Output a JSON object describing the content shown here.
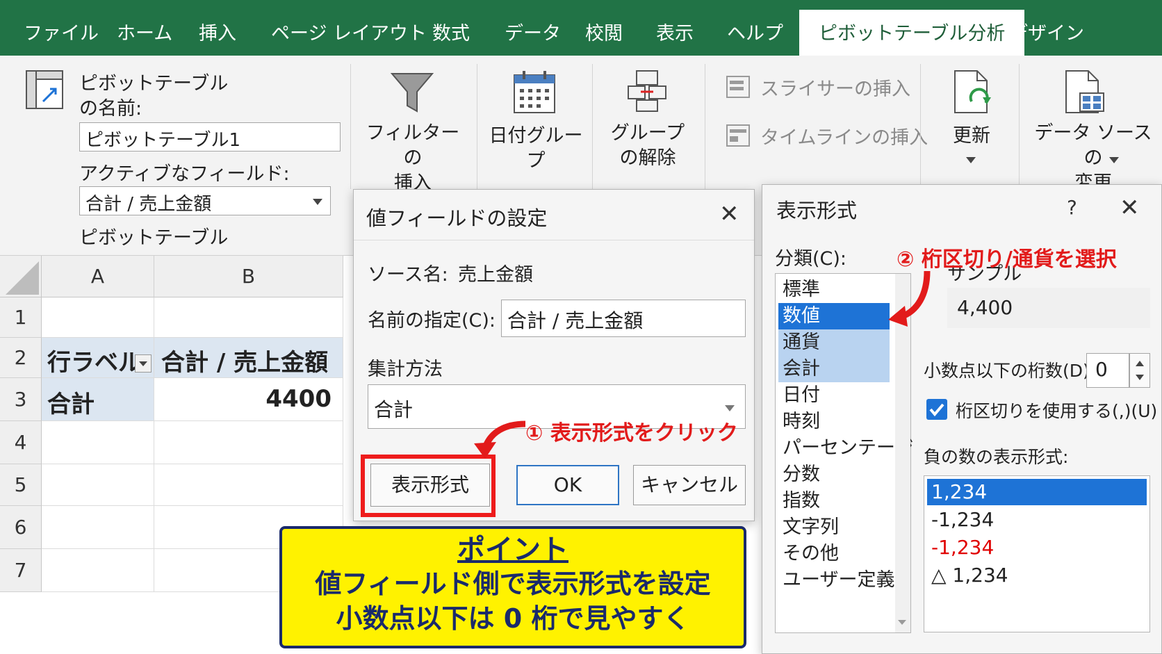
{
  "tabs": [
    "ファイル",
    "ホーム",
    "挿入",
    "ページ レイアウト",
    "数式",
    "データ",
    "校閲",
    "表示",
    "ヘルプ",
    "ピボットテーブル分析",
    "デザイン"
  ],
  "ribbon": {
    "pt_name_label_1": "ピボットテーブル",
    "pt_name_label_2": "の名前:",
    "pt_name_value": "ピボットテーブル1",
    "active_field_label": "アクティブなフィールド:",
    "active_field_value": "合計 / 売上金額",
    "group_label": "ピボットテーブル",
    "filter_1": "フィルターの",
    "filter_2": "挿入",
    "date_group": "日付グループ",
    "ungroup_1": "グループ",
    "ungroup_2": "の解除",
    "slicer": "スライサーの挿入",
    "timeline": "タイムラインの挿入",
    "refresh": "更新",
    "datasource_1": "データ ソースの",
    "datasource_2": "変更"
  },
  "sheet": {
    "columns": [
      "A",
      "B"
    ],
    "rows": [
      "1",
      "2",
      "3",
      "4",
      "5",
      "6",
      "7"
    ],
    "row_label_header": "行ラベル",
    "sum_header": "合計 / 売上金額",
    "total_label": "合計",
    "total_value": "4400"
  },
  "value_field_dialog": {
    "title": "値フィールドの設定",
    "source_label": "ソース名:",
    "source_value": "売上金額",
    "name_label": "名前の指定(C):",
    "name_value": "合計 / 売上金額",
    "agg_label": "集計方法",
    "agg_value": "合計",
    "format_button": "表示形式",
    "ok_button": "OK",
    "cancel_button": "キャンセル"
  },
  "format_dialog": {
    "title": "表示形式",
    "help": "?",
    "category_label": "分類(C):",
    "categories": [
      "標準",
      "数値",
      "通貨",
      "会計",
      "日付",
      "時刻",
      "パーセンテージ",
      "分数",
      "指数",
      "文字列",
      "その他",
      "ユーザー定義"
    ],
    "selected_category": "数値",
    "sample_label": "サンプル",
    "sample_value": "4,400",
    "decimals_label": "小数点以下の桁数(D):",
    "decimals_value": "0",
    "separator_label": "桁区切りを使用する(,)(U)",
    "separator_checked": true,
    "negative_label": "負の数の表示形式:",
    "negative_formats": [
      "1,234",
      "-1,234",
      "-1,234",
      "△ 1,234"
    ]
  },
  "annotations": {
    "step1": "① 表示形式をクリック",
    "step2": "② 桁区切り/通貨を選択",
    "point_title": "ポイント",
    "point_line1": "値フィールド側で表示形式を設定",
    "point_line2": "小数点以下は 0 桁で見やすく"
  },
  "colors": {
    "excel_green": "#217346",
    "selection_blue": "#1e73d6",
    "annotation_red": "#e21b1b",
    "point_yellow": "#fff200",
    "point_navy": "#1a2a6b"
  }
}
